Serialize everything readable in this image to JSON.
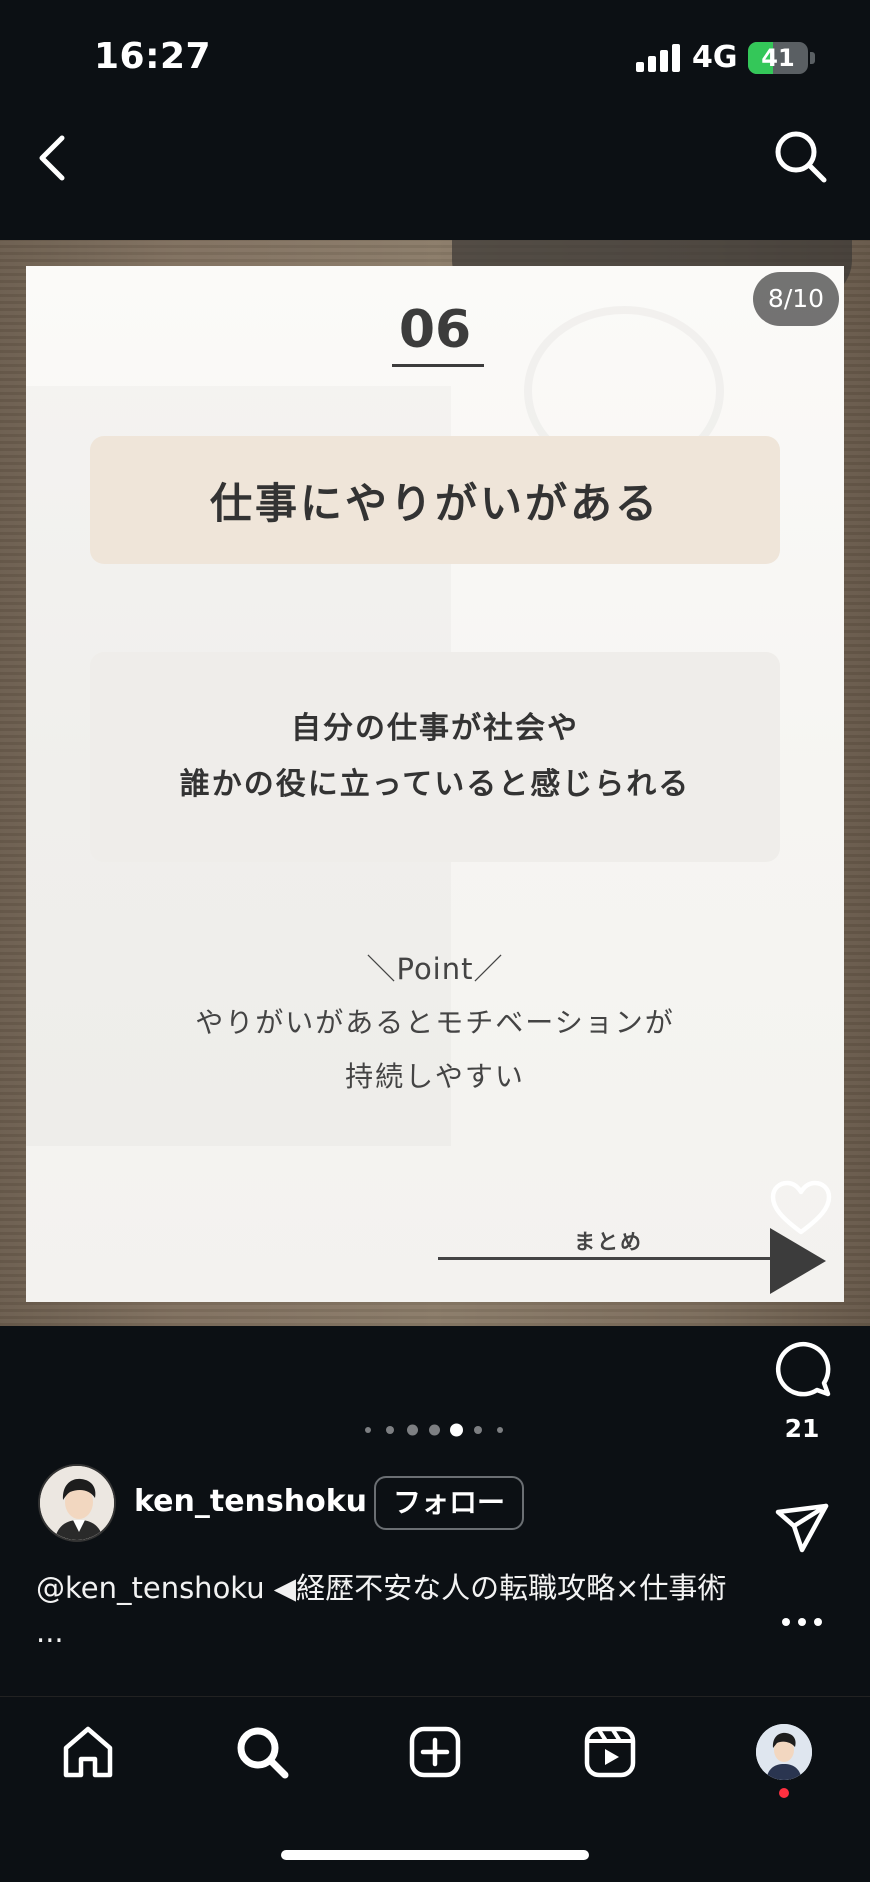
{
  "status_bar": {
    "time": "16:27",
    "network": "4G",
    "battery_text": "41",
    "battery_level": 0.41,
    "battery_color": "#34c759"
  },
  "header": {
    "back_icon": "chevron-left-icon",
    "search_icon": "search-icon"
  },
  "post": {
    "counter": "8/10",
    "card": {
      "number": "06",
      "title": "仕事にやりがいがある",
      "description_lines": [
        "自分の仕事が社会や",
        "誰かの役に立っていると感じられる"
      ],
      "point_heading": "＼Point／",
      "point_lines": [
        "やりがいがあるとモチベーションが",
        "持続しやすい"
      ],
      "next_label": "まとめ",
      "title_box_color": "#efe5d9"
    },
    "carousel": {
      "total": 7,
      "active_index": 4
    },
    "actions": {
      "like_icon": "heart-icon",
      "comment_icon": "comment-icon",
      "comment_count": "21",
      "share_icon": "paper-plane-icon",
      "more_icon": "more-horizontal-icon"
    },
    "author": {
      "username": "ken_tenshoku",
      "follow_label": "フォロー"
    },
    "caption": "@ken_tenshoku ◀経歴不安な人の転職攻略×仕事術 ..."
  },
  "bottom_nav": {
    "items": [
      {
        "name": "home-icon"
      },
      {
        "name": "search-icon"
      },
      {
        "name": "create-post-icon"
      },
      {
        "name": "reels-icon"
      },
      {
        "name": "profile-avatar"
      }
    ],
    "notification_color": "#ff3040"
  }
}
